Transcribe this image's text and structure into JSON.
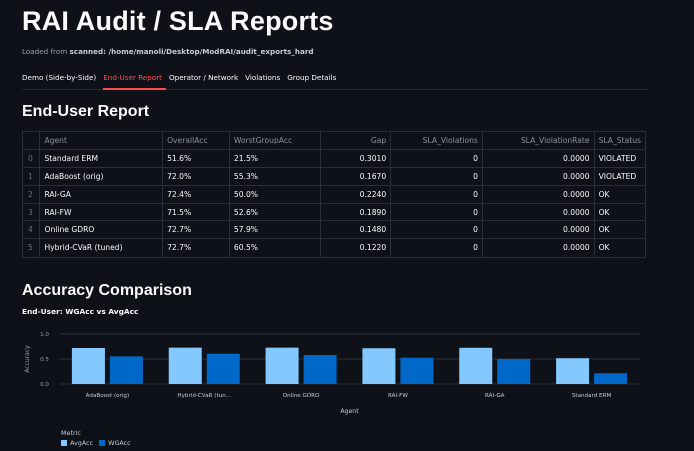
{
  "title": "RAI Audit / SLA Reports",
  "loaded": {
    "prefix": "Loaded from ",
    "path": "scanned: /home/manoli/Desktop/ModRAI/audit_exports_hard"
  },
  "tabs": [
    {
      "label": "Demo (Side-by-Side)",
      "active": false
    },
    {
      "label": "End-User Report",
      "active": true
    },
    {
      "label": "Operator / Network",
      "active": false
    },
    {
      "label": "Violations",
      "active": false
    },
    {
      "label": "Group Details",
      "active": false
    }
  ],
  "report": {
    "heading": "End-User Report",
    "columns": [
      "",
      "Agent",
      "OverallAcc",
      "WorstGroupAcc",
      "Gap",
      "SLA_Violations",
      "SLA_ViolationRate",
      "SLA_Status"
    ],
    "rows": [
      [
        "0",
        "Standard ERM",
        "51.6%",
        "21.5%",
        "0.3010",
        "0",
        "0.0000",
        "VIOLATED"
      ],
      [
        "1",
        "AdaBoost (orig)",
        "72.0%",
        "55.3%",
        "0.1670",
        "0",
        "0.0000",
        "VIOLATED"
      ],
      [
        "2",
        "RAI-GA",
        "72.4%",
        "50.0%",
        "0.2240",
        "0",
        "0.0000",
        "OK"
      ],
      [
        "3",
        "RAI-FW",
        "71.5%",
        "52.6%",
        "0.1890",
        "0",
        "0.0000",
        "OK"
      ],
      [
        "4",
        "Online GDRO",
        "72.7%",
        "57.9%",
        "0.1480",
        "0",
        "0.0000",
        "OK"
      ],
      [
        "5",
        "Hybrid-CVaR (tuned)",
        "72.7%",
        "60.5%",
        "0.1220",
        "0",
        "0.0000",
        "OK"
      ]
    ]
  },
  "accuracy": {
    "heading": "Accuracy Comparison",
    "chart_title": "End-User: WGAcc vs AvgAcc"
  },
  "colors": {
    "avg": "#83c9ff",
    "wg": "#0068c9",
    "grid": "#2b2f38"
  },
  "chart_data": {
    "type": "bar",
    "title": "End-User: WGAcc vs AvgAcc",
    "xlabel": "Agent",
    "ylabel": "Accuracy",
    "ylim": [
      0,
      1.0
    ],
    "yticks": [
      "0.0",
      "0.5",
      "1.0"
    ],
    "categories": [
      "AdaBoost (orig)",
      "Hybrid-CVaR (tun...",
      "Online GDRO",
      "RAI-FW",
      "RAI-GA",
      "Standard ERM"
    ],
    "series": [
      {
        "name": "AvgAcc",
        "values": [
          0.72,
          0.727,
          0.727,
          0.715,
          0.724,
          0.516
        ]
      },
      {
        "name": "WGAcc",
        "values": [
          0.553,
          0.605,
          0.579,
          0.526,
          0.5,
          0.215
        ]
      }
    ],
    "legend_title": "Metric",
    "legend_position": "bottom-left"
  }
}
